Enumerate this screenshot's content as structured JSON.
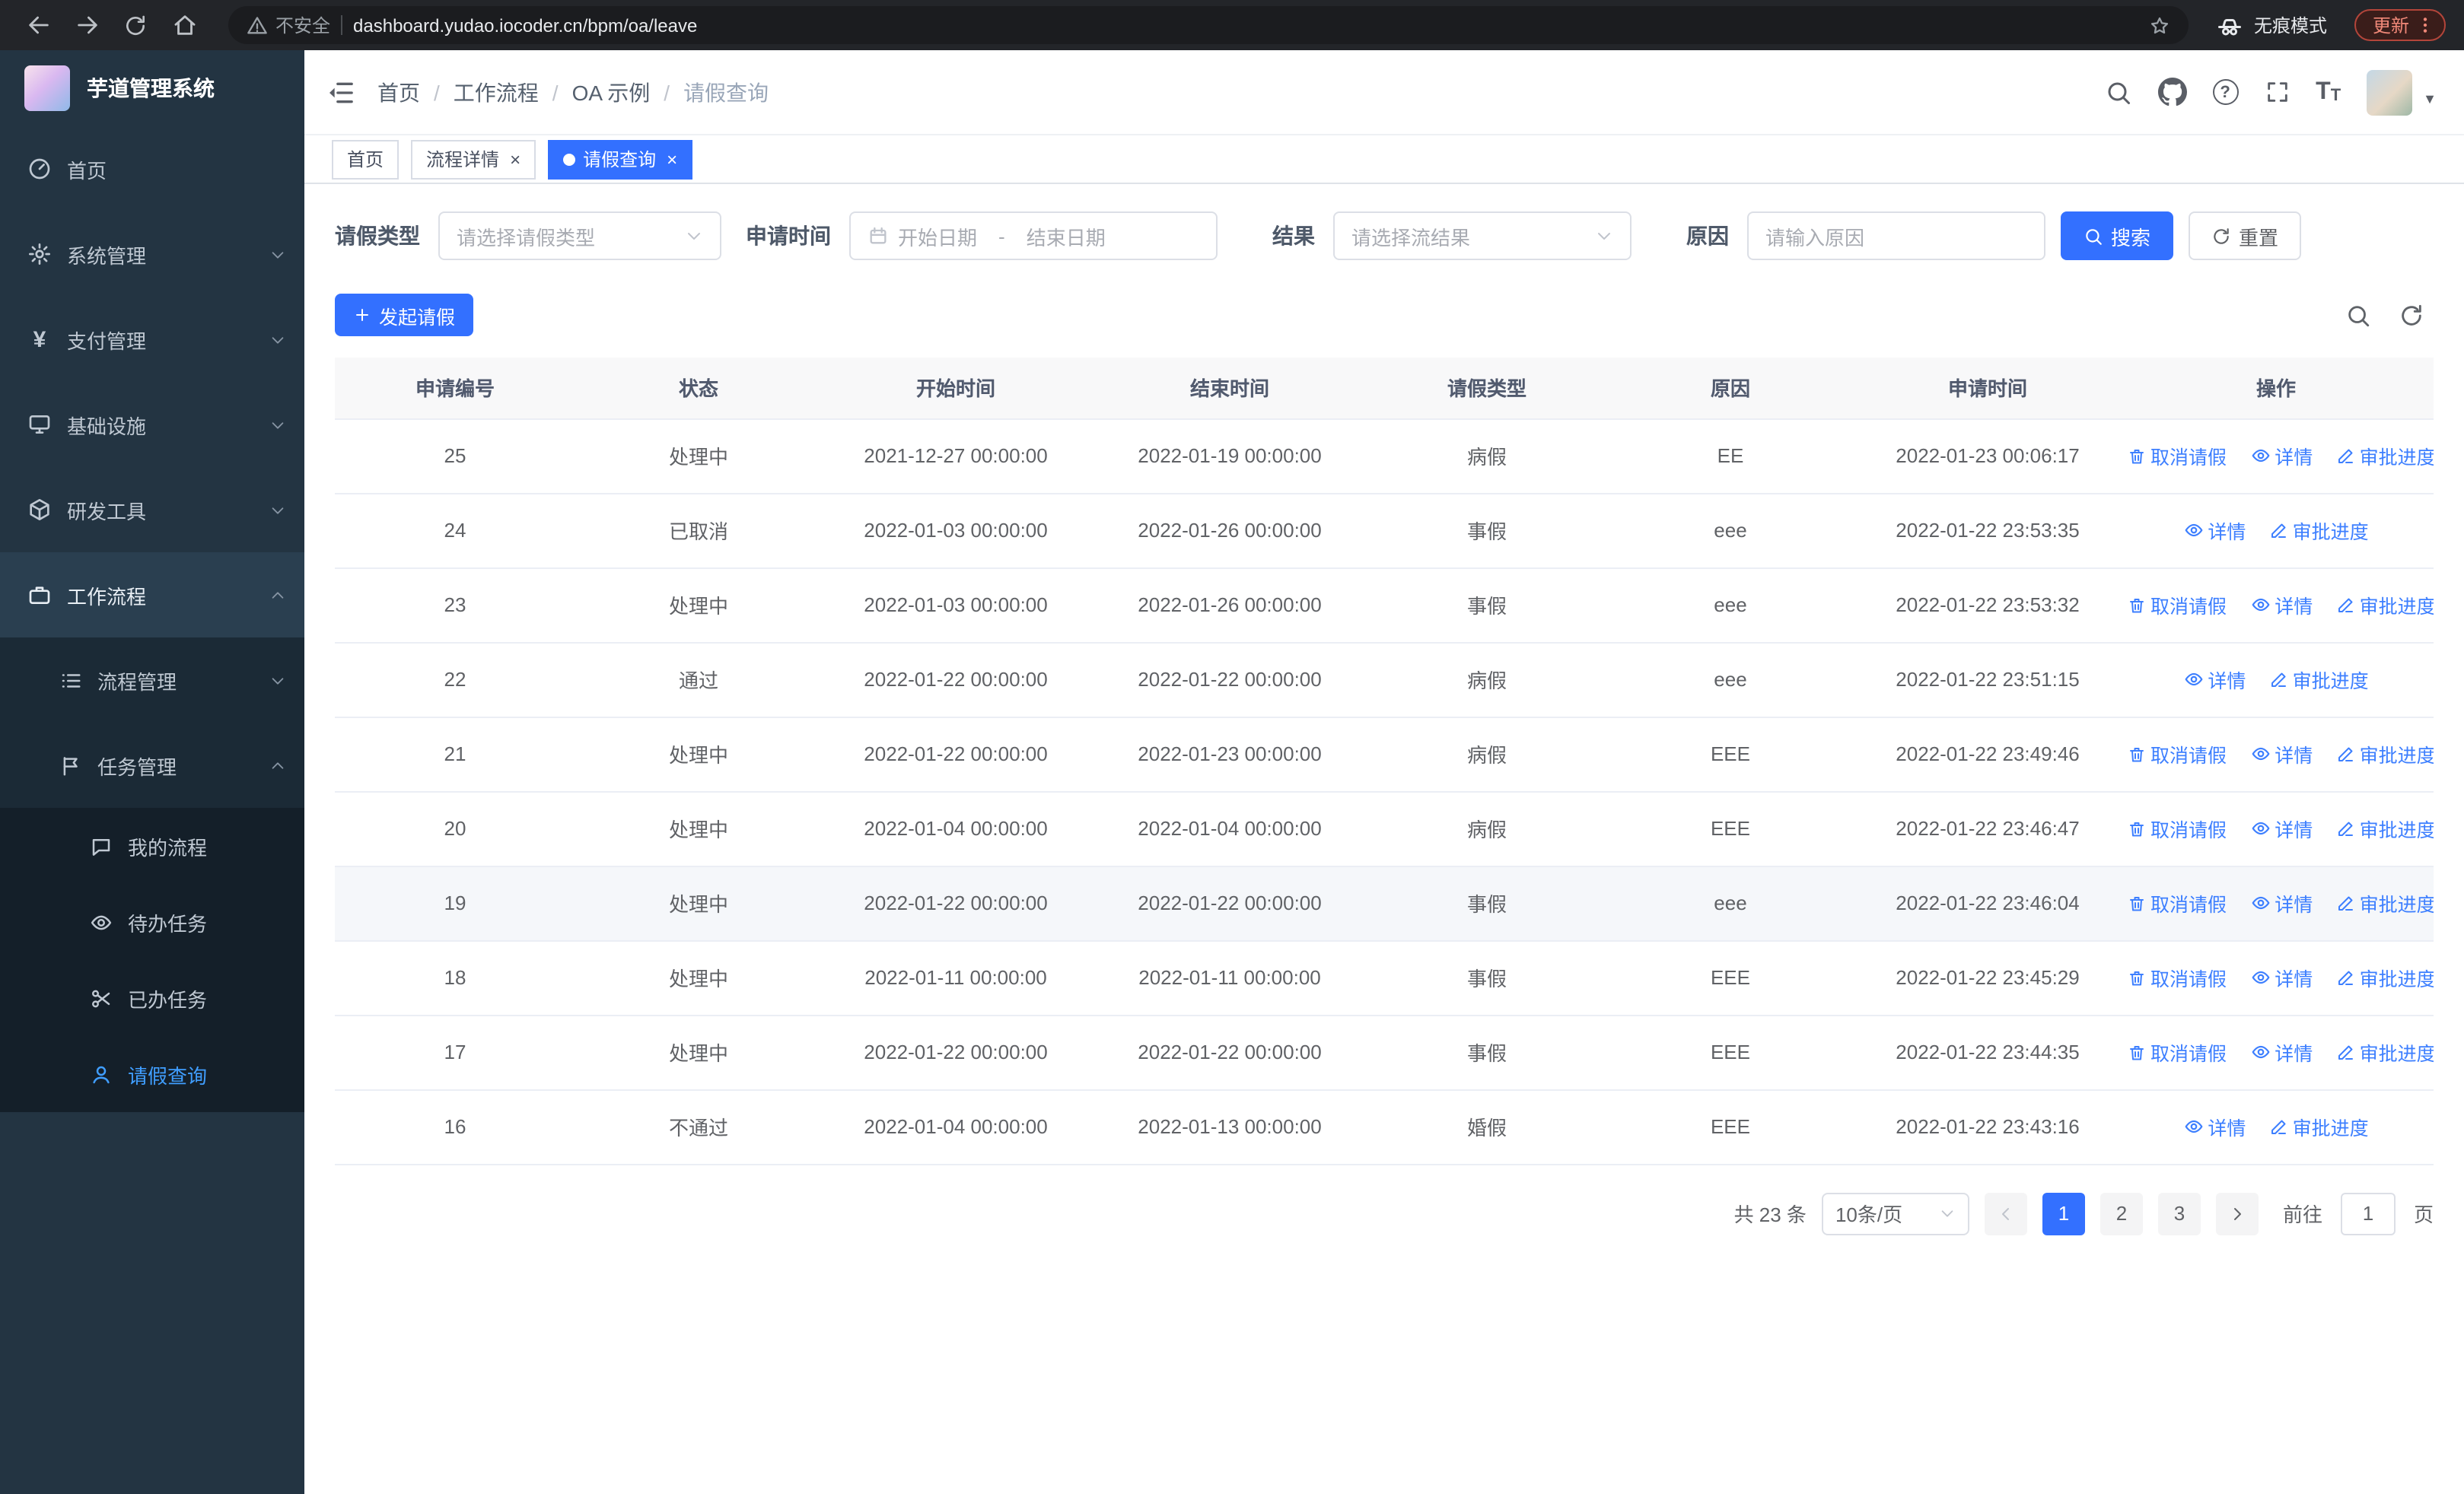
{
  "colors": {
    "primary": "#3370ff",
    "link": "#3d7fff",
    "sidebar_bg": "#233442",
    "sidebar_sub_bg": "#1b2a36",
    "sidebar_leaf_bg": "#141f29",
    "sidebar_active_bg": "#2a3f50",
    "sidebar_active_text": "#409eff"
  },
  "browser": {
    "security_label": "不安全",
    "url": "dashboard.yudao.iocoder.cn/bpm/oa/leave",
    "incognito_label": "无痕模式",
    "update_label": "更新"
  },
  "sidebar": {
    "logo_title": "芋道管理系统",
    "menu": {
      "home": "首页",
      "system": "系统管理",
      "payment": "支付管理",
      "infra": "基础设施",
      "devtools": "研发工具",
      "workflow": "工作流程",
      "process_mgmt": "流程管理",
      "task_mgmt": "任务管理",
      "my_process": "我的流程",
      "todo_tasks": "待办任务",
      "done_tasks": "已办任务",
      "leave_query": "请假查询"
    }
  },
  "navbar": {
    "breadcrumb": [
      "首页",
      "工作流程",
      "OA 示例",
      "请假查询"
    ]
  },
  "tabs": {
    "home": "首页",
    "process_detail": "流程详情",
    "leave_query": "请假查询"
  },
  "filters": {
    "leave_type_label": "请假类型",
    "leave_type_placeholder": "请选择请假类型",
    "apply_time_label": "申请时间",
    "date_start_placeholder": "开始日期",
    "date_separator": "-",
    "date_end_placeholder": "结束日期",
    "result_label": "结果",
    "result_placeholder": "请选择流结果",
    "reason_label": "原因",
    "reason_placeholder": "请输入原因",
    "search_button": "搜索",
    "reset_button": "重置"
  },
  "toolbar": {
    "create_button": "发起请假"
  },
  "table": {
    "columns": [
      "申请编号",
      "状态",
      "开始时间",
      "结束时间",
      "请假类型",
      "原因",
      "申请时间",
      "操作"
    ],
    "action_labels": {
      "cancel": "取消请假",
      "detail": "详情",
      "progress": "审批进度"
    },
    "rows": [
      {
        "id": "25",
        "status": "处理中",
        "start": "2021-12-27 00:00:00",
        "end": "2022-01-19 00:00:00",
        "type": "病假",
        "reason": "EE",
        "apply_time": "2022-01-23 00:06:17",
        "cancellable": true,
        "highlighted": false
      },
      {
        "id": "24",
        "status": "已取消",
        "start": "2022-01-03 00:00:00",
        "end": "2022-01-26 00:00:00",
        "type": "事假",
        "reason": "eee",
        "apply_time": "2022-01-22 23:53:35",
        "cancellable": false,
        "highlighted": false
      },
      {
        "id": "23",
        "status": "处理中",
        "start": "2022-01-03 00:00:00",
        "end": "2022-01-26 00:00:00",
        "type": "事假",
        "reason": "eee",
        "apply_time": "2022-01-22 23:53:32",
        "cancellable": true,
        "highlighted": false
      },
      {
        "id": "22",
        "status": "通过",
        "start": "2022-01-22 00:00:00",
        "end": "2022-01-22 00:00:00",
        "type": "病假",
        "reason": "eee",
        "apply_time": "2022-01-22 23:51:15",
        "cancellable": false,
        "highlighted": false
      },
      {
        "id": "21",
        "status": "处理中",
        "start": "2022-01-22 00:00:00",
        "end": "2022-01-23 00:00:00",
        "type": "病假",
        "reason": "EEE",
        "apply_time": "2022-01-22 23:49:46",
        "cancellable": true,
        "highlighted": false
      },
      {
        "id": "20",
        "status": "处理中",
        "start": "2022-01-04 00:00:00",
        "end": "2022-01-04 00:00:00",
        "type": "病假",
        "reason": "EEE",
        "apply_time": "2022-01-22 23:46:47",
        "cancellable": true,
        "highlighted": false
      },
      {
        "id": "19",
        "status": "处理中",
        "start": "2022-01-22 00:00:00",
        "end": "2022-01-22 00:00:00",
        "type": "事假",
        "reason": "eee",
        "apply_time": "2022-01-22 23:46:04",
        "cancellable": true,
        "highlighted": true
      },
      {
        "id": "18",
        "status": "处理中",
        "start": "2022-01-11 00:00:00",
        "end": "2022-01-11 00:00:00",
        "type": "事假",
        "reason": "EEE",
        "apply_time": "2022-01-22 23:45:29",
        "cancellable": true,
        "highlighted": false
      },
      {
        "id": "17",
        "status": "处理中",
        "start": "2022-01-22 00:00:00",
        "end": "2022-01-22 00:00:00",
        "type": "事假",
        "reason": "EEE",
        "apply_time": "2022-01-22 23:44:35",
        "cancellable": true,
        "highlighted": false
      },
      {
        "id": "16",
        "status": "不通过",
        "start": "2022-01-04 00:00:00",
        "end": "2022-01-13 00:00:00",
        "type": "婚假",
        "reason": "EEE",
        "apply_time": "2022-01-22 23:43:16",
        "cancellable": false,
        "highlighted": false
      }
    ]
  },
  "pagination": {
    "total_text": "共 23 条",
    "page_size": "10条/页",
    "pages": [
      "1",
      "2",
      "3"
    ],
    "active_page": "1",
    "goto_prefix": "前往",
    "goto_value": "1",
    "goto_suffix": "页"
  }
}
